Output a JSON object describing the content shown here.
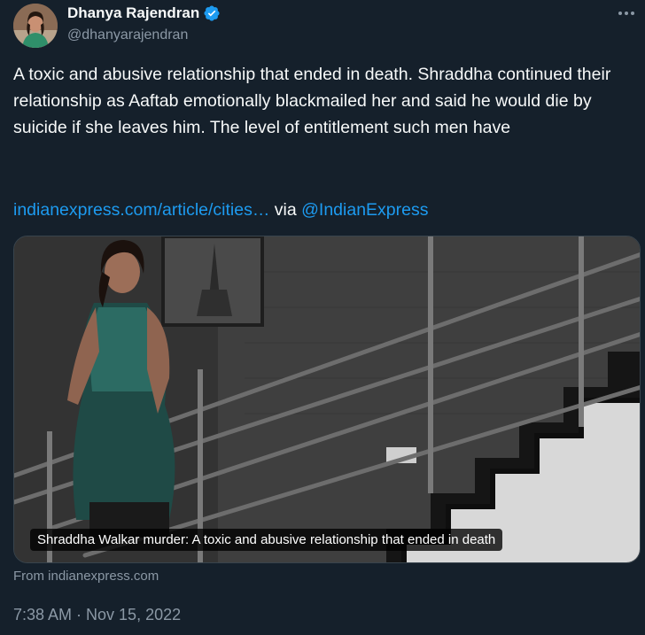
{
  "author": {
    "display_name": "Dhanya Rajendran",
    "handle": "@dhanyarajendran",
    "verified_icon": "verified-badge-icon",
    "avatar_icon": "avatar"
  },
  "more_icon": "more-icon",
  "tweet": {
    "text": "A toxic and abusive relationship that ended in death. Shraddha continued their relationship as Aaftab emotionally blackmailed her and said he would die by suicide if she leaves him. The level of entitlement such men have",
    "link_text": "indianexpress.com/article/cities…",
    "via_text": " via ",
    "mention": "@IndianExpress"
  },
  "card": {
    "caption": "Shraddha Walkar murder: A toxic and abusive relationship that ended in death",
    "source": "From indianexpress.com"
  },
  "timestamp": "7:38 AM · Nov 15, 2022",
  "colors": {
    "background": "#15202b",
    "text_primary": "#f7f9f9",
    "text_secondary": "#8b98a5",
    "link": "#1d9bf0",
    "verified": "#1d9bf0"
  }
}
